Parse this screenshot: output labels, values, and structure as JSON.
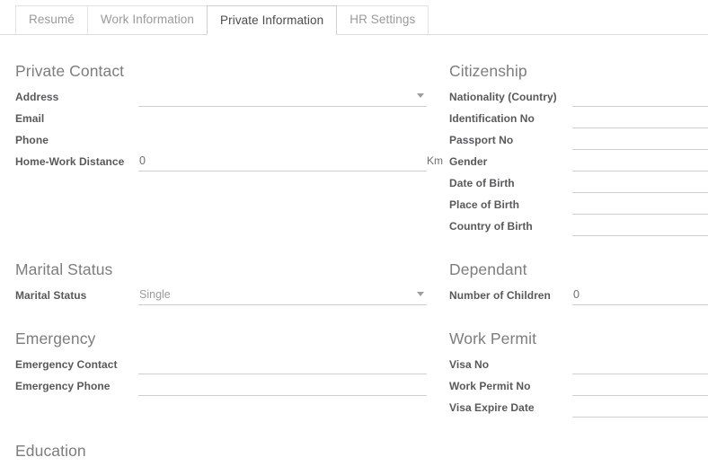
{
  "tabs": [
    {
      "label": "Resumé",
      "active": false
    },
    {
      "label": "Work Information",
      "active": false
    },
    {
      "label": "Private Information",
      "active": true
    },
    {
      "label": "HR Settings",
      "active": false
    }
  ],
  "groups": {
    "private_contact": {
      "title": "Private Contact",
      "fields": [
        {
          "label": "Address",
          "value": "",
          "widget": "dropdown"
        },
        {
          "label": "Email",
          "value": "",
          "widget": "blank"
        },
        {
          "label": "Phone",
          "value": "",
          "widget": "blank"
        },
        {
          "label": "Home-Work Distance",
          "value": "0",
          "widget": "number",
          "suffix": "Km"
        }
      ]
    },
    "citizenship": {
      "title": "Citizenship",
      "fields": [
        {
          "label": "Nationality (Country)",
          "value": "",
          "widget": "text"
        },
        {
          "label": "Identification No",
          "value": "",
          "widget": "text"
        },
        {
          "label": "Passport No",
          "value": "",
          "widget": "text"
        },
        {
          "label": "Gender",
          "value": "",
          "widget": "text"
        },
        {
          "label": "Date of Birth",
          "value": "",
          "widget": "text"
        },
        {
          "label": "Place of Birth",
          "value": "",
          "widget": "text"
        },
        {
          "label": "Country of Birth",
          "value": "",
          "widget": "text"
        }
      ]
    },
    "marital_status": {
      "title": "Marital Status",
      "fields": [
        {
          "label": "Marital Status",
          "value": "Single",
          "widget": "dropdown"
        }
      ]
    },
    "dependant": {
      "title": "Dependant",
      "fields": [
        {
          "label": "Number of Children",
          "value": "0",
          "widget": "number"
        }
      ]
    },
    "emergency": {
      "title": "Emergency",
      "fields": [
        {
          "label": "Emergency Contact",
          "value": "",
          "widget": "text"
        },
        {
          "label": "Emergency Phone",
          "value": "",
          "widget": "text"
        }
      ]
    },
    "work_permit": {
      "title": "Work Permit",
      "fields": [
        {
          "label": "Visa No",
          "value": "",
          "widget": "text"
        },
        {
          "label": "Work Permit No",
          "value": "",
          "widget": "text"
        },
        {
          "label": "Visa Expire Date",
          "value": "",
          "widget": "text"
        }
      ]
    },
    "education": {
      "title": "Education",
      "fields": []
    }
  },
  "colors": {
    "label": "#59595b",
    "group_title": "#7d7d7d",
    "underline": "#cfcfcf",
    "tab_active_text": "#4c4c4c",
    "tab_text": "#9a9a9a"
  }
}
